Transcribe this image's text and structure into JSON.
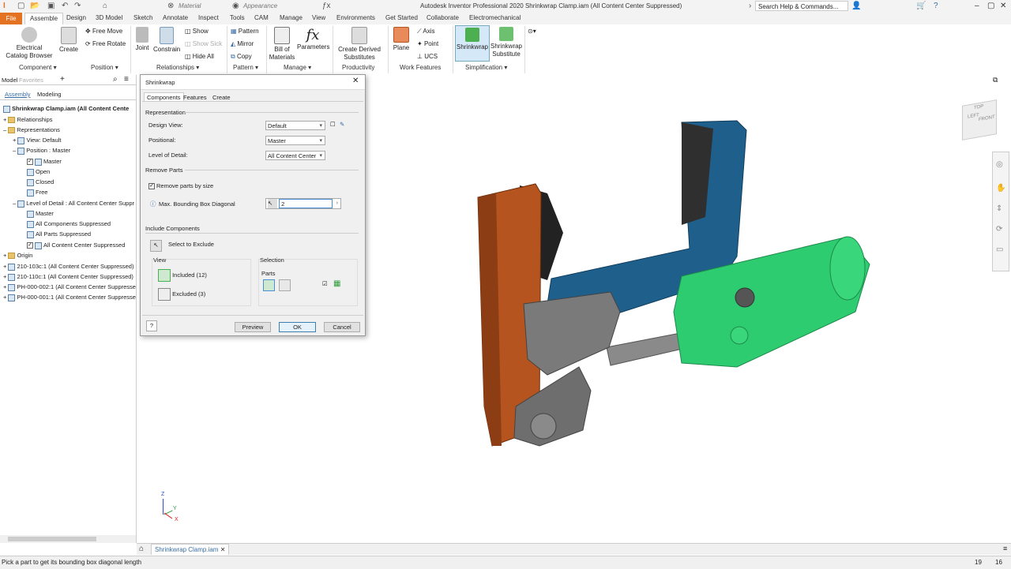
{
  "app": {
    "title": "Autodesk Inventor Professional 2020    Shrinkwrap Clamp.iam (All Content Center Suppressed)",
    "material": "Material",
    "appearance": "Appearance",
    "search_placeholder": "Search Help & Commands..."
  },
  "tabs": [
    "File",
    "Assemble",
    "Design",
    "3D Model",
    "Sketch",
    "Annotate",
    "Inspect",
    "Tools",
    "CAM",
    "Manage",
    "View",
    "Environments",
    "Get Started",
    "Collaborate",
    "Electromechanical"
  ],
  "active_tab": "Assemble",
  "ribbon": {
    "component": {
      "electrical": "Electrical Catalog Browser",
      "create": "Create",
      "panel": "Component"
    },
    "position": {
      "free_move": "Free Move",
      "free_rotate": "Free Rotate",
      "panel": "Position"
    },
    "relationships": {
      "joint": "Joint",
      "constrain": "Constrain",
      "show": "Show",
      "show_sick": "Show Sick",
      "hide_all": "Hide All",
      "panel": "Relationships"
    },
    "pattern": {
      "pattern": "Pattern",
      "mirror": "Mirror",
      "copy": "Copy",
      "panel": "Pattern"
    },
    "manage": {
      "bom": "Bill of Materials",
      "parameters": "Parameters",
      "panel": "Manage"
    },
    "productivity": {
      "derived": "Create Derived Substitutes",
      "panel": "Productivity"
    },
    "work_features": {
      "plane": "Plane",
      "axis": "Axis",
      "point": "Point",
      "ucs": "UCS",
      "panel": "Work Features"
    },
    "simplification": {
      "shrinkwrap": "Shrinkwrap",
      "shrinkwrap_sub": "Shrinkwrap Substitute",
      "panel": "Simplification"
    }
  },
  "browser": {
    "tabs": [
      "Model",
      "Favorites"
    ],
    "subtabs": [
      "Assembly",
      "Modeling"
    ],
    "items": [
      "Shrinkwrap Clamp.iam (All Content Cente",
      "Relationships",
      "Representations",
      "View: Default",
      "Position : Master",
      "Master",
      "Open",
      "Closed",
      "Free",
      "Level of Detail : All Content Center Suppr",
      "Master",
      "All Components Suppressed",
      "All Parts Suppressed",
      "All Content Center Suppressed",
      "Origin",
      "210-103c:1 (All Content Center Suppressed)",
      "210-110c:1 (All Content Center Suppressed)",
      "PH-000-002:1 (All Content Center Suppresse",
      "PH-000-001:1 (All Content Center Suppresse"
    ]
  },
  "dialog": {
    "title": "Shrinkwrap",
    "tabs": [
      "Components",
      "Features",
      "Create"
    ],
    "representation": "Representation",
    "design_view_label": "Design View:",
    "design_view_value": "Default",
    "positional_label": "Positional:",
    "positional_value": "Master",
    "lod_label": "Level of Detail:",
    "lod_value": "All Content Center",
    "remove_parts": "Remove Parts",
    "remove_by_size": "Remove parts by size",
    "bbox_label": "Max. Bounding Box Diagonal",
    "bbox_value": "2",
    "include_components": "Include Components",
    "select_to_exclude": "Select to Exclude",
    "view": "View",
    "included": "Included (12)",
    "excluded": "Excluded (3)",
    "selection": "Selection",
    "parts": "Parts",
    "preview": "Preview",
    "ok": "OK",
    "cancel": "Cancel"
  },
  "viewcube": {
    "top": "TOP",
    "front": "FRONT",
    "left": "LEFT"
  },
  "triad": {
    "x": "X",
    "y": "Y",
    "z": "Z"
  },
  "doc_tab": "Shrinkwrap Clamp.iam",
  "status": {
    "message": "Pick a part to get its bounding box diagonal length",
    "count1": "19",
    "count2": "16"
  },
  "colors": {
    "file_tab": "#e37222",
    "shrinkwrap_green": "#2ecc71",
    "plate_blue": "#1f5f8b",
    "plate_orange": "#b5541e"
  }
}
